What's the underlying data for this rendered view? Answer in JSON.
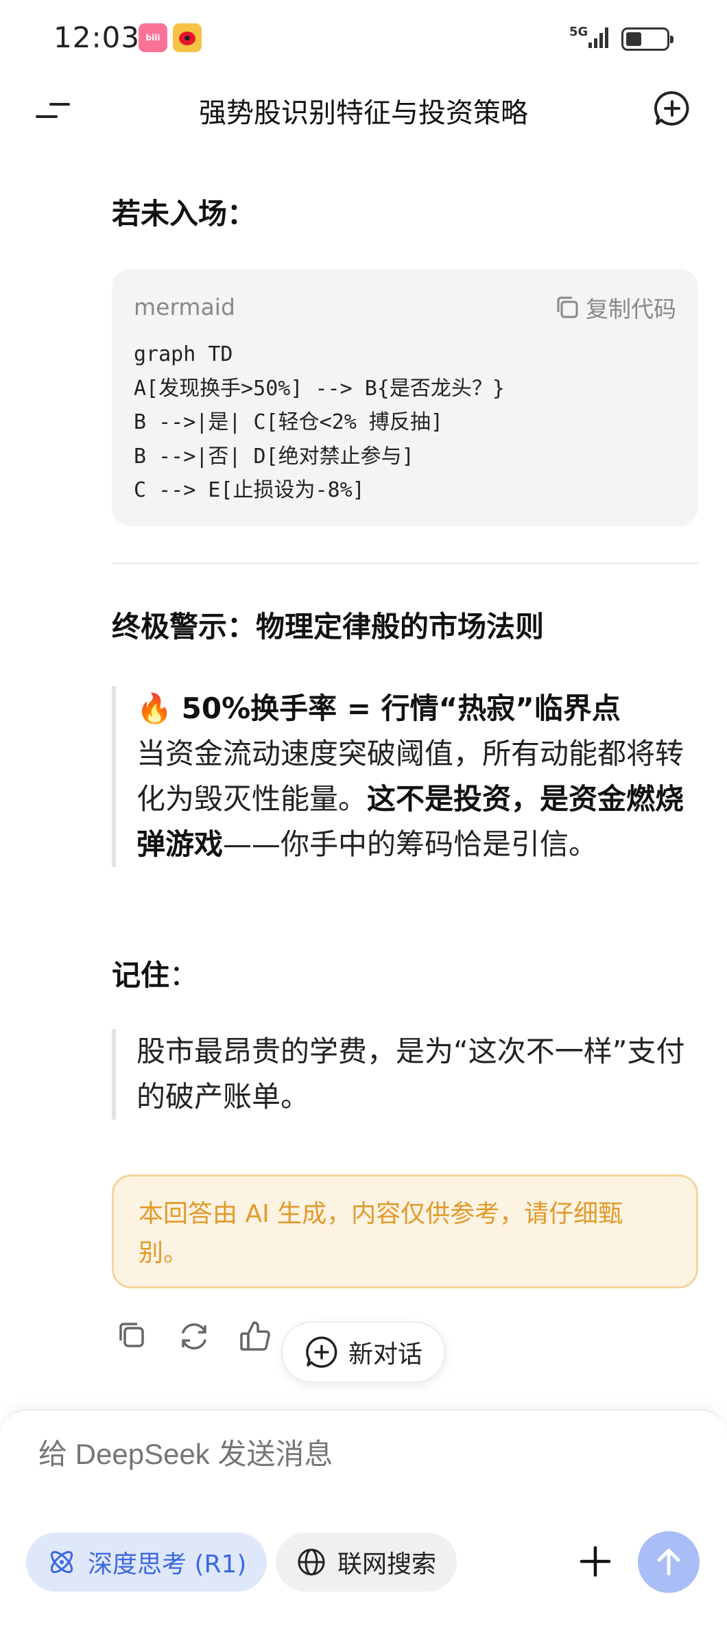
{
  "status_bar": {
    "time": "12:03",
    "network": "5G",
    "apps": [
      "bilibili-icon",
      "weibo-icon"
    ]
  },
  "header": {
    "title": "强势股识别特征与投资策略"
  },
  "message": {
    "section_not_entered": "若未入场：",
    "code_block": {
      "language": "mermaid",
      "copy_label": "复制代码",
      "lines": [
        "graph TD",
        "A[发现换手>50%] --> B{是否龙头？}",
        "B -->|是| C[轻仓<2% 搏反抽]",
        "B -->|否| D[绝对禁止参与]",
        "C --> E[止损设为-8%]"
      ]
    },
    "section_warning": "终极警示：物理定律般的市场法则",
    "warning_quote": {
      "emoji": "🔥",
      "headline": "50%换手率 = 行情“热寂”临界点",
      "text_1": "当资金流动速度突破阈值，所有动能都将转化为毁灭性能量。",
      "bold_1": "这不是投资，是资金燃烧弹游戏",
      "text_2": "——你手中的筹码恰是引信。"
    },
    "remember_label": "记住",
    "remember_colon": "：",
    "remember_quote": "股市最昂贵的学费，是为“这次不一样”支付的破产账单。",
    "disclaimer": "本回答由 AI 生成，内容仅供参考，请仔细甄别。"
  },
  "actions": {
    "new_chat_label": "新对话",
    "icons": [
      "copy-icon",
      "regenerate-icon",
      "thumbs-up-icon",
      "thumbs-down-icon"
    ]
  },
  "composer": {
    "placeholder": "给 DeepSeek 发送消息",
    "deep_think_label": "深度思考 (R1)",
    "web_search_label": "联网搜索"
  },
  "colors": {
    "accent_blue": "#3c68e0",
    "send_button": "#a9bdf6",
    "disclaimer_text": "#e19a2a",
    "disclaimer_bg": "#fdf3e3"
  }
}
